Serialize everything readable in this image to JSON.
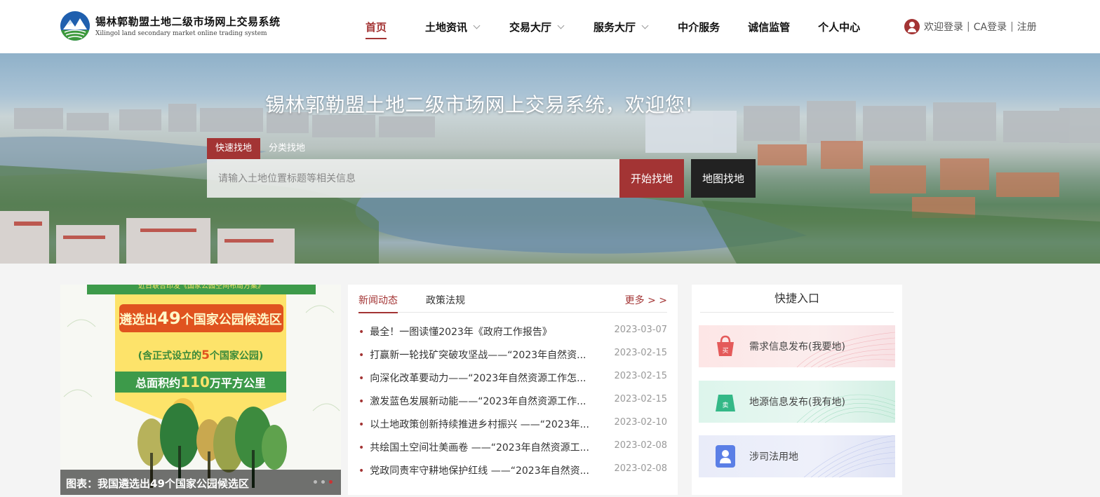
{
  "header": {
    "logo_title": "锡林郭勒盟土地二级市场网上交易系统",
    "logo_subtitle": "Xilingol land secondary market online trading system",
    "nav": [
      {
        "label": "首页",
        "active": true,
        "has_dropdown": false
      },
      {
        "label": "土地资讯",
        "active": false,
        "has_dropdown": true
      },
      {
        "label": "交易大厅",
        "active": false,
        "has_dropdown": true
      },
      {
        "label": "服务大厅",
        "active": false,
        "has_dropdown": true
      },
      {
        "label": "中介服务",
        "active": false,
        "has_dropdown": false
      },
      {
        "label": "诚信监管",
        "active": false,
        "has_dropdown": false
      },
      {
        "label": "个人中心",
        "active": false,
        "has_dropdown": false
      }
    ],
    "user": {
      "login_label": "欢迎登录",
      "ca_label": "CA登录",
      "register_label": "注册",
      "separator": "|"
    }
  },
  "banner": {
    "title": "锡林郭勒盟土地二级市场网上交易系统，欢迎您!",
    "tabs": [
      "快速找地",
      "分类找地"
    ],
    "search_placeholder": "请输入土地位置标题等相关信息",
    "search_button": "开始找地",
    "map_button": "地图找地"
  },
  "feature": {
    "caption": "图表：我国遴选出49个国家公园候选区",
    "poster_top": "近日联合印发《国家公园空间布局方案》",
    "poster_line1_a": "遴选出",
    "poster_line1_num": "49",
    "poster_line1_b": "个国家公园候选区",
    "poster_line2_a": "(含正式设立的",
    "poster_line2_num": "5",
    "poster_line2_b": "个国家公园)",
    "poster_line3_a": "总面积约",
    "poster_line3_num": "110",
    "poster_line3_b": "万平方公里",
    "dots": 3,
    "active_dot": 3
  },
  "news": {
    "tabs": [
      "新闻动态",
      "政策法规"
    ],
    "more": "更多 > >",
    "items": [
      {
        "title": "最全！一图读懂2023年《政府工作报告》",
        "date": "2023-03-07"
      },
      {
        "title": "打赢新一轮找矿突破攻坚战——“2023年自然资...",
        "date": "2023-02-15"
      },
      {
        "title": "向深化改革要动力——“2023年自然资源工作怎...",
        "date": "2023-02-15"
      },
      {
        "title": "激发蓝色发展新动能——“2023年自然资源工作...",
        "date": "2023-02-15"
      },
      {
        "title": "以土地政策创新持续推进乡村振兴 ——“2023年...",
        "date": "2023-02-10"
      },
      {
        "title": "共绘国土空间壮美画卷 ——“2023年自然资源工...",
        "date": "2023-02-08"
      },
      {
        "title": "党政同责牢守耕地保护红线 ——“2023年自然资...",
        "date": "2023-02-08"
      }
    ]
  },
  "quick": {
    "title": "快捷入口",
    "items": [
      {
        "label": "需求信息发布(我要地)",
        "icon": "demand-icon",
        "color": "#e45a5a"
      },
      {
        "label": "地源信息发布(我有地)",
        "icon": "supply-icon",
        "color": "#34b887"
      },
      {
        "label": "涉司法用地",
        "icon": "judicial-user-icon",
        "color": "#5b7fe6"
      }
    ]
  },
  "colors": {
    "accent": "#a33434",
    "dark_button": "#222222"
  }
}
